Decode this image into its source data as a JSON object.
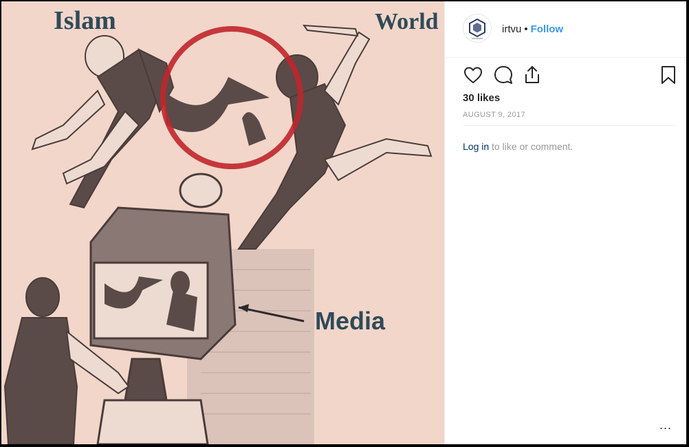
{
  "post": {
    "image": {
      "alt_labels": {
        "top_left": "Islam",
        "top_right": "World",
        "center": "Media"
      },
      "colors": {
        "paper": "#f2d6c9",
        "ink": "#5a4a48",
        "circle": "#c0262b",
        "label": "#2f4a5a"
      }
    }
  },
  "header": {
    "username": "irtvu",
    "separator": "•",
    "follow_label": "Follow",
    "avatar_icon": "hexagon-emblem-icon"
  },
  "actions": {
    "icons": [
      "heart-icon",
      "comment-icon",
      "share-icon",
      "bookmark-icon"
    ]
  },
  "stats": {
    "likes": "30 likes",
    "date": "AUGUST 9, 2017"
  },
  "login": {
    "link_text": "Log in",
    "rest_text": " to like or comment."
  },
  "footer": {
    "more_label": "..."
  },
  "theme": {
    "accent": "#3897f0",
    "text": "#262626",
    "muted": "#999999",
    "link_dark": "#003569"
  }
}
